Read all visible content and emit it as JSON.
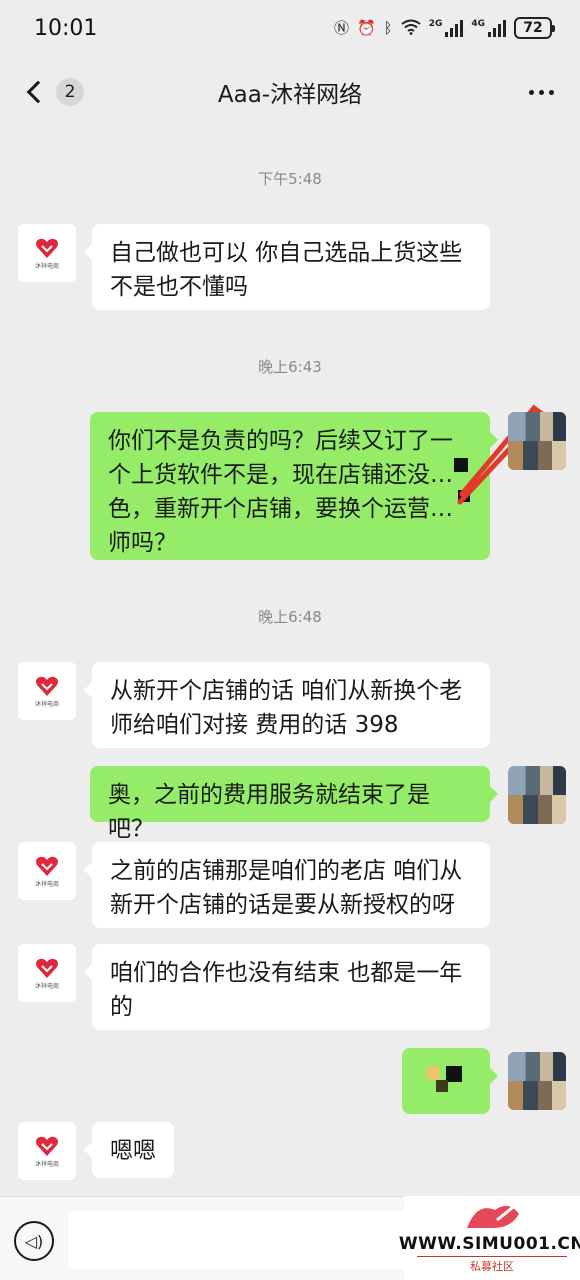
{
  "status_bar": {
    "time": "10:01",
    "net_2g": "2G",
    "net_4g": "4G",
    "battery": "72"
  },
  "nav": {
    "back_badge": "2",
    "title": "Aaa-沐祥网络"
  },
  "avatar_logo_text": "沐祥电商",
  "messages": [
    {
      "type": "time",
      "text": "下午5:48"
    },
    {
      "type": "in",
      "text": "自己做也可以 你自己选品上货这些不是也不懂吗"
    },
    {
      "type": "time",
      "text": "晚上6:43"
    },
    {
      "type": "out",
      "text": "你们不是负责的吗？后续又订了一个上货软件不是，现在店铺还没…色，重新开个店铺，要换个运营…师吗？"
    },
    {
      "type": "time",
      "text": "晚上6:48"
    },
    {
      "type": "in",
      "text": "从新开个店铺的话 咱们从新换个老师给咱们对接 费用的话 398"
    },
    {
      "type": "out",
      "text": "奥，之前的费用服务就结束了是吧？"
    },
    {
      "type": "in",
      "text": "之前的店铺那是咱们的老店 咱们从新开个店铺的话是要从新授权的呀"
    },
    {
      "type": "in",
      "text": "咱们的合作也没有结束 也都是一年的"
    },
    {
      "type": "out",
      "text": ""
    },
    {
      "type": "in",
      "text": "嗯嗯"
    }
  ],
  "input": {
    "placeholder": ""
  },
  "watermark": {
    "site": "WWW.SIMU001.CN",
    "sub": "私募社区"
  },
  "colors": {
    "background": "#ededed",
    "bubble_out": "#95ec69",
    "bubble_in": "#ffffff",
    "brand_red": "#e0283c"
  },
  "icons": [
    "nfc-icon",
    "alarm-icon",
    "bluetooth-icon",
    "wifi-icon",
    "signal-icon",
    "battery-icon",
    "back-icon",
    "more-icon",
    "voice-icon"
  ]
}
